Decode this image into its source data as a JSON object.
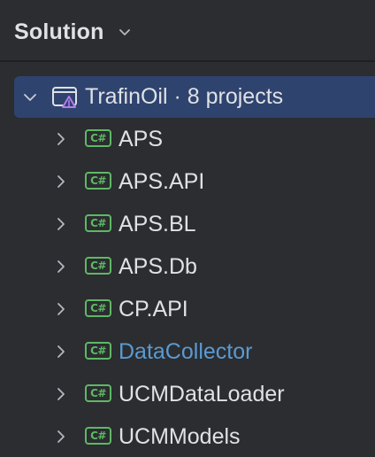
{
  "panel": {
    "title": "Solution",
    "title_icon": "chevron-down-icon"
  },
  "solution": {
    "name": "TrafinOil",
    "separator": " · ",
    "count_text": "8 projects",
    "expanded": true,
    "icon": "solution-icon"
  },
  "projects": [
    {
      "label": "APS",
      "badge": "C#",
      "highlighted": false
    },
    {
      "label": "APS.API",
      "badge": "C#",
      "highlighted": false
    },
    {
      "label": "APS.BL",
      "badge": "C#",
      "highlighted": false
    },
    {
      "label": "APS.Db",
      "badge": "C#",
      "highlighted": false
    },
    {
      "label": "CP.API",
      "badge": "C#",
      "highlighted": false
    },
    {
      "label": "DataCollector",
      "badge": "C#",
      "highlighted": true
    },
    {
      "label": "UCMDataLoader",
      "badge": "C#",
      "highlighted": false
    },
    {
      "label": "UCMModels",
      "badge": "C#",
      "highlighted": false
    }
  ],
  "colors": {
    "background": "#2b2d30",
    "selection": "#2e436e",
    "text": "#dfe1e5",
    "csharp_badge": "#5fb865",
    "highlight_text": "#5b9ad1",
    "chevron": "#b4b8bf"
  }
}
